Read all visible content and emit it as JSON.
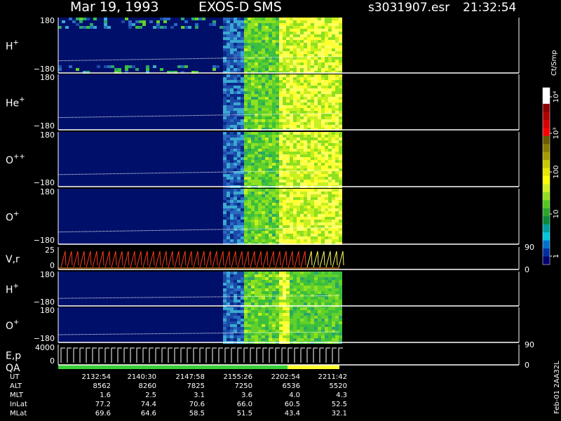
{
  "header": {
    "date": "Mar 19, 1993",
    "mission": "EXOS-D SMS",
    "file": "s3031907.esr",
    "time": "21:32:54"
  },
  "panels": [
    {
      "label": "H",
      "sup": "+",
      "ymax": "180",
      "ymin": "−180"
    },
    {
      "label": "He",
      "sup": "+",
      "ymax": "180",
      "ymin": "−180"
    },
    {
      "label": "O",
      "sup": "++",
      "ymax": "180",
      "ymin": "−180"
    },
    {
      "label": "O",
      "sup": "+",
      "ymax": "180",
      "ymin": "−180"
    },
    {
      "label": "V,r",
      "sup": "",
      "ymax": "25",
      "ymin": "0",
      "right_top": "90",
      "right_bottom": "0"
    },
    {
      "label": "H",
      "sup": "+",
      "ymax": "180",
      "ymin": "−180"
    },
    {
      "label": "O",
      "sup": "+",
      "ymax": "180",
      "ymin": "−180"
    },
    {
      "label": "E,p",
      "sup": "",
      "ymax": "4000",
      "ymin": "0",
      "right_top": "90",
      "right_bottom": "0"
    },
    {
      "label": "QA",
      "sup": "",
      "ymax": "",
      "ymin": ""
    }
  ],
  "colorbar": {
    "title": "Ct/Smp",
    "ticks": [
      "10⁴",
      "10³",
      "100",
      "10",
      "1"
    ],
    "colors": [
      "#ffffff",
      "#ffffff",
      "#8b0000",
      "#b00000",
      "#d80000",
      "#ff0000",
      "#6b5a00",
      "#8b7a00",
      "#a89b00",
      "#c8c800",
      "#e6e600",
      "#ffff00",
      "#d0f020",
      "#90e020",
      "#50c820",
      "#2aa52a",
      "#0a8a3a",
      "#00a0a0",
      "#00c8e0",
      "#0070d0",
      "#0030a0",
      "#000070"
    ]
  },
  "chart_data": {
    "type": "heatmap",
    "title": "Mar 19, 1993   EXOS-D SMS",
    "x_axis": {
      "rows": [
        {
          "name": "UT",
          "values": [
            "2132:54",
            "2140:30",
            "2147:58",
            "2155:26",
            "2202:54",
            "2211:42"
          ]
        },
        {
          "name": "ALT",
          "values": [
            "8562",
            "8260",
            "7825",
            "7250",
            "6536",
            "5520"
          ]
        },
        {
          "name": "MLT",
          "values": [
            "1.6",
            "2.5",
            "3.1",
            "3.6",
            "4.0",
            "4.3"
          ]
        },
        {
          "name": "InLat",
          "values": [
            "77.2",
            "74.4",
            "70.6",
            "66.0",
            "60.5",
            "52.5"
          ]
        },
        {
          "name": "MLat",
          "values": [
            "69.6",
            "64.6",
            "58.5",
            "51.5",
            "43.4",
            "32.1"
          ]
        }
      ]
    },
    "colorbar_range": [
      1,
      10000
    ],
    "colorbar_scale": "log",
    "colorbar_unit": "Ct/Smp"
  },
  "footer": {
    "side_note": "Feb-01 2AA32L"
  }
}
